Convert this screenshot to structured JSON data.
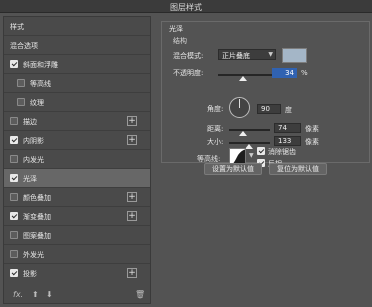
{
  "window": {
    "title": "图层样式"
  },
  "left_panel": {
    "rows": [
      {
        "label": "样式"
      },
      {
        "label": "混合选项"
      },
      {
        "label": "斜面和浮雕",
        "checked": true
      },
      {
        "label": "等高线",
        "checked": false
      },
      {
        "label": "纹理",
        "checked": false
      },
      {
        "label": "描边",
        "checked": false,
        "plus": "+"
      },
      {
        "label": "内阴影",
        "checked": true,
        "plus": "+"
      },
      {
        "label": "内发光",
        "checked": false
      },
      {
        "label": "光泽",
        "checked": true,
        "active": true
      },
      {
        "label": "颜色叠加",
        "checked": false,
        "plus": "+"
      },
      {
        "label": "渐变叠加",
        "checked": true,
        "plus": "+"
      },
      {
        "label": "图案叠加",
        "checked": false
      },
      {
        "label": "外发光",
        "checked": false
      },
      {
        "label": "投影",
        "checked": true,
        "plus": "+"
      }
    ],
    "bottom_icons": {
      "fx": "fx.",
      "up": "⬆",
      "down": "⬇",
      "trash": "🗑"
    }
  },
  "satin": {
    "group_title": "光泽",
    "section_title": "结构",
    "blend_mode_label": "混合模式:",
    "blend_mode_value": "正片叠底",
    "color_hex": "#a4b6c7",
    "opacity_label": "不透明度:",
    "opacity_value": "34",
    "opacity_unit": "%",
    "opacity_level": 0.34,
    "angle_label": "角度:",
    "angle_value": "90",
    "angle_unit": "度",
    "distance_label": "距离:",
    "distance_value": "74",
    "distance_unit": "像素",
    "size_label": "大小:",
    "size_value": "133",
    "size_unit": "像素",
    "contour_label": "等高线:",
    "antialias_label": "消除锯齿",
    "antialias_checked": true,
    "invert_label": "反相",
    "invert_checked": true,
    "set_default_label": "设置为默认值",
    "reset_default_label": "复位为默认值"
  }
}
